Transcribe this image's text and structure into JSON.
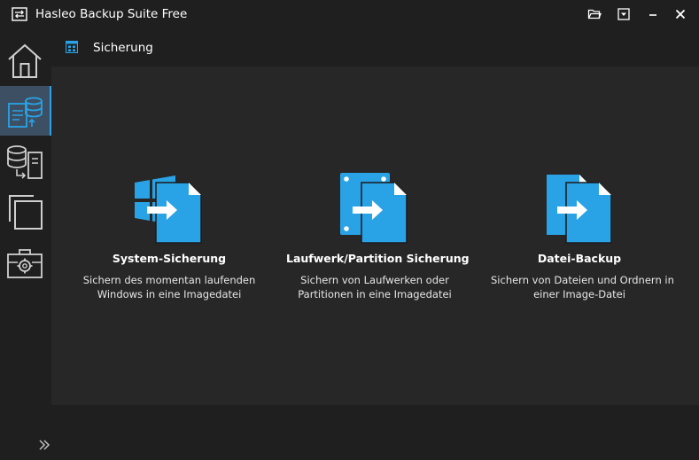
{
  "window": {
    "title": "Hasleo Backup Suite Free",
    "controls": [
      "folder-open-icon",
      "dropdown-menu-icon",
      "minimize-icon",
      "close-icon"
    ]
  },
  "sidebar": {
    "items": [
      {
        "name": "home",
        "icon": "home-icon"
      },
      {
        "name": "backup",
        "icon": "backup-icon",
        "active": true
      },
      {
        "name": "restore",
        "icon": "restore-icon"
      },
      {
        "name": "clone",
        "icon": "clone-icon"
      },
      {
        "name": "tools",
        "icon": "toolbox-icon"
      }
    ],
    "expand_icon": "double-chevron-right-icon"
  },
  "header": {
    "title": "Sicherung",
    "icon": "grid-icon"
  },
  "cards": [
    {
      "title": "System-Sicherung",
      "desc_line1": "Sichern des momentan laufenden",
      "desc_line2": "Windows in eine Imagedatei",
      "icon": "windows-backup-icon"
    },
    {
      "title": "Laufwerk/Partition Sicherung",
      "desc_line1": "Sichern von Laufwerken oder",
      "desc_line2": "Partitionen in eine Imagedatei",
      "icon": "disk-backup-icon"
    },
    {
      "title": "Datei-Backup",
      "desc_line1": "Sichern von Dateien und Ordnern in",
      "desc_line2": "einer Image-Datei",
      "icon": "file-backup-icon"
    }
  ],
  "colors": {
    "accent": "#29a3e6",
    "background": "#1b1b1b",
    "panel": "#272727",
    "active_nav": "#3d4f63"
  }
}
